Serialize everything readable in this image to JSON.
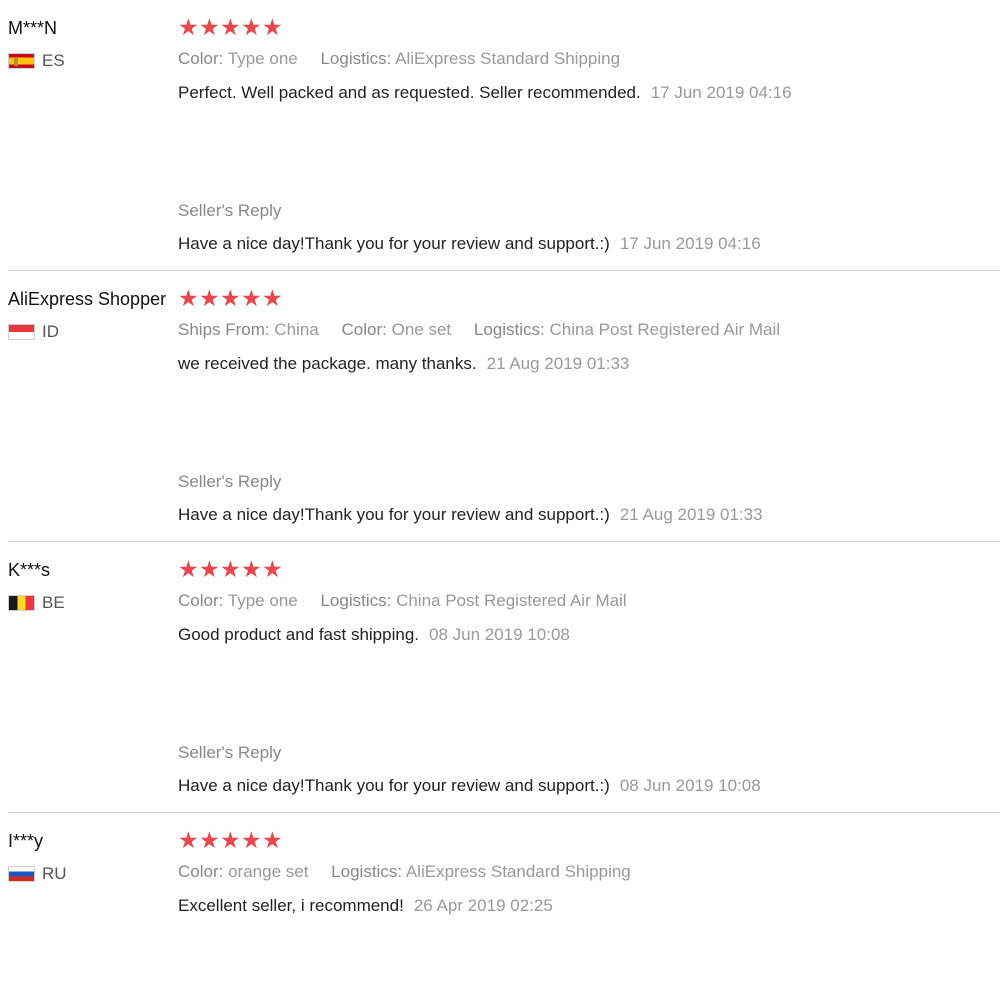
{
  "reviews": [
    {
      "user": "M***N",
      "country": "ES",
      "flag": "flag-es",
      "stars": 5,
      "meta": [
        {
          "key": "Color:",
          "value": "Type one"
        },
        {
          "key": "Logistics:",
          "value": "AliExpress Standard Shipping"
        }
      ],
      "text": "Perfect. Well packed and as requested. Seller recommended.",
      "date": "17 Jun 2019 04:16",
      "reply_label": "Seller's Reply",
      "reply_text": "Have a nice day!Thank you for your review and support.:)",
      "reply_date": "17 Jun 2019 04:16"
    },
    {
      "user": "AliExpress Shopper",
      "country": "ID",
      "flag": "flag-id",
      "stars": 5,
      "meta": [
        {
          "key": "Ships From:",
          "value": "China"
        },
        {
          "key": "Color:",
          "value": "One set"
        },
        {
          "key": "Logistics:",
          "value": "China Post Registered Air Mail"
        }
      ],
      "text": "we received the package. many thanks.",
      "date": "21 Aug 2019 01:33",
      "reply_label": "Seller's Reply",
      "reply_text": "Have a nice day!Thank you for your review and support.:)",
      "reply_date": "21 Aug 2019 01:33"
    },
    {
      "user": "K***s",
      "country": "BE",
      "flag": "flag-be",
      "stars": 5,
      "meta": [
        {
          "key": "Color:",
          "value": "Type one"
        },
        {
          "key": "Logistics:",
          "value": "China Post Registered Air Mail"
        }
      ],
      "text": "Good product and fast shipping.",
      "date": "08 Jun 2019 10:08",
      "reply_label": "Seller's Reply",
      "reply_text": "Have a nice day!Thank you for your review and support.:)",
      "reply_date": "08 Jun 2019 10:08"
    },
    {
      "user": "I***y",
      "country": "RU",
      "flag": "flag-ru",
      "stars": 5,
      "meta": [
        {
          "key": "Color:",
          "value": "orange set"
        },
        {
          "key": "Logistics:",
          "value": "AliExpress Standard Shipping"
        }
      ],
      "text": "Excellent seller, i recommend!",
      "date": "26 Apr 2019 02:25",
      "reply_label": "",
      "reply_text": "",
      "reply_date": ""
    }
  ],
  "colors": {
    "star": "#e8474e",
    "muted": "#999999",
    "text": "#222222",
    "divider": "#d6d6d6"
  }
}
